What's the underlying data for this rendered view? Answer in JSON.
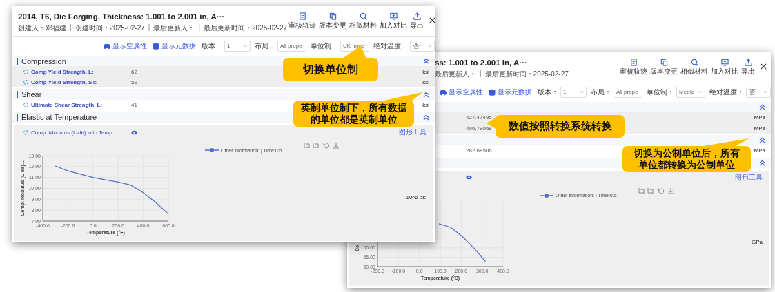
{
  "windows": [
    {
      "title": "2014, T6, Die Forging, Thickness: 1.001 to 2.001 in, A···",
      "meta": [
        "创建人：邓福建",
        "|",
        "创建时间：2025-02-27",
        "|",
        "最后更新人：",
        "|",
        "最后更新时间：2025-02-27"
      ],
      "actions": [
        {
          "kind": "audit",
          "label": "审核轨迹"
        },
        {
          "kind": "version",
          "label": "版本变更"
        },
        {
          "kind": "similar",
          "label": "相似材料"
        },
        {
          "kind": "compare",
          "label": "加入对比"
        },
        {
          "kind": "export",
          "label": "导出"
        }
      ],
      "toggles": [
        "显示空属性",
        "显示元数据"
      ],
      "filters": [
        {
          "label": "版本：",
          "value": "1"
        },
        {
          "label": "布局：",
          "value": "All prope"
        },
        {
          "label": "单位制：",
          "value": "UK Impe"
        },
        {
          "label": "绝对温度：",
          "value": "否"
        }
      ],
      "sections": [
        {
          "title": "Compression",
          "expanded": true,
          "rows": [
            {
              "name": "Comp Yield Strength, L:",
              "value": "62",
              "unit": "ksi"
            },
            {
              "name": "Comp Yield Strength, ST:",
              "value": "59",
              "unit": "ksi"
            }
          ]
        },
        {
          "title": "Shear",
          "expanded": true,
          "rows": [
            {
              "name": "Ultimate Shear Strength, L:",
              "value": "41",
              "unit": "ksi"
            }
          ]
        },
        {
          "title": "Elastic at Temperature",
          "expanded": true
        }
      ],
      "chart_panel": {
        "name": "Comp. Modulus (L-dir) with Temp.",
        "tools": "图形工具",
        "unit": "10^6 psi",
        "chart_data": {
          "type": "line",
          "xlabel": "Temperature (°F)",
          "ylabel": "Comp. Modulus (L-dir)...",
          "x": [
            -300,
            -200,
            -100,
            0,
            100,
            200,
            300,
            400,
            500,
            600
          ],
          "series": [
            {
              "name": "Other information: | Time:0.5",
              "color": "#5470c6",
              "values": [
                12.05,
                11.6,
                11.3,
                11.0,
                10.78,
                10.58,
                10.3,
                9.6,
                8.7,
                7.65
              ]
            }
          ],
          "grid": true,
          "xlim": [
            -400,
            600
          ],
          "ylim": [
            7,
            13
          ],
          "xticks": [
            {
              "value": -400,
              "label": "-400.0"
            },
            {
              "value": -200,
              "label": "-200.0"
            },
            {
              "value": 0,
              "label": "0.0"
            },
            {
              "value": 200,
              "label": "200.0"
            },
            {
              "value": 400,
              "label": "400.0"
            },
            {
              "value": 600,
              "label": "600.0"
            }
          ],
          "yticks": [
            {
              "value": 7,
              "label": "7.00"
            },
            {
              "value": 8,
              "label": "8.00"
            },
            {
              "value": 9,
              "label": "9.00"
            },
            {
              "value": 10,
              "label": "10.00"
            },
            {
              "value": 11,
              "label": "11.00"
            },
            {
              "value": 12,
              "label": "12.00"
            },
            {
              "value": 13,
              "label": "13.00"
            }
          ]
        }
      }
    },
    {
      "title": "ss: 1.001 to 2.001 in, A···",
      "meta": [
        "最后更新人：",
        "|",
        "最后更新时间：2025-02-27"
      ],
      "actions": [
        {
          "kind": "audit",
          "label": "审核轨迹"
        },
        {
          "kind": "version",
          "label": "版本变更"
        },
        {
          "kind": "similar",
          "label": "相似材料"
        },
        {
          "kind": "compare",
          "label": "加入对比"
        },
        {
          "kind": "export",
          "label": "导出"
        }
      ],
      "toggles": [
        "显示空属性",
        "显示元数据"
      ],
      "filters": [
        {
          "label": "版本：",
          "value": "1"
        },
        {
          "label": "布局：",
          "value": "All prope"
        },
        {
          "label": "单位制：",
          "value": "Metric"
        },
        {
          "label": "绝对温度：",
          "value": "否"
        }
      ],
      "sections": [
        {
          "expanded": true,
          "rows": [
            {
              "value": "427.47495",
              "unit": "MPa"
            },
            {
              "value": "406.79068",
              "unit": "MPa"
            }
          ]
        },
        {
          "expanded": true,
          "rows": [
            {
              "value": "282.68506",
              "unit": "MPa"
            }
          ]
        },
        {
          "expanded": true
        }
      ],
      "chart_panel": {
        "tools": "图形工具",
        "unit": "GPa",
        "chart_data": {
          "type": "line",
          "xlabel": "Temperature (°C)",
          "ylabel": "Co",
          "x": [
            93,
            149,
            204,
            260,
            316
          ],
          "series": [
            {
              "name": "Other information: | Time:0.5",
              "color": "#5470c6",
              "values": [
                72.9,
                71.0,
                66.2,
                60.0,
                52.7
              ]
            }
          ],
          "grid": true,
          "xlim": [
            -200,
            400
          ],
          "ylim": [
            50,
            85
          ],
          "xticks": [
            {
              "value": -200,
              "label": "-200.0"
            },
            {
              "value": -100,
              "label": "-100.0"
            },
            {
              "value": 0,
              "label": "0.0"
            },
            {
              "value": 100,
              "label": "100.0"
            },
            {
              "value": 200,
              "label": "200.0"
            },
            {
              "value": 300,
              "label": "300.0"
            },
            {
              "value": 400,
              "label": "400.0"
            }
          ],
          "yticks": [
            {
              "value": 50,
              "label": "50.00"
            },
            {
              "value": 55,
              "label": "55.00"
            },
            {
              "value": 60,
              "label": "60.00"
            }
          ]
        }
      }
    }
  ],
  "callouts": [
    {
      "text": "切换单位制"
    },
    {
      "text": "英制单位制下，所有数据的单位都是英制单位"
    },
    {
      "text": "数值按照转换系统转换"
    },
    {
      "text": "切换为公制单位后，所有单位都转换为公制单位"
    }
  ]
}
